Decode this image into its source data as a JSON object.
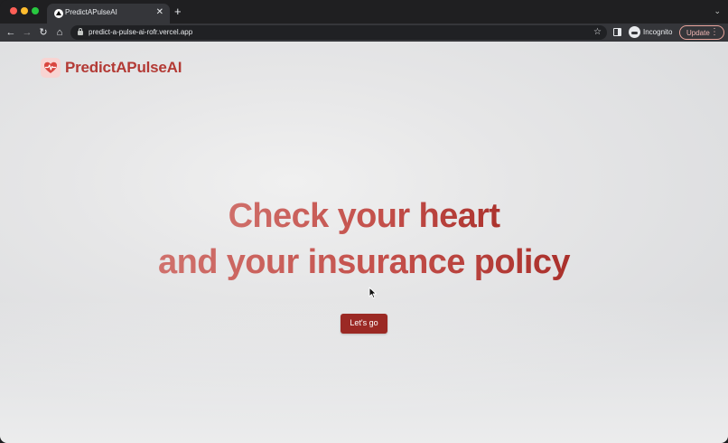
{
  "browser": {
    "tab_title": "PredictAPulseAI",
    "tab_close": "✕",
    "new_tab": "+",
    "tab_menu": "⌄",
    "url": "predict-a-pulse-ai-rofr.vercel.app",
    "incognito_label": "Incognito",
    "update_label": "Update",
    "update_menu": "⋮",
    "nav": {
      "back": "←",
      "forward": "→",
      "reload": "↻",
      "home": "⌂",
      "bookmark": "☆"
    }
  },
  "page": {
    "logo_text": "PredictAPulseAI",
    "hero_line_1": "Check your heart",
    "hero_line_2": "and your insurance policy",
    "cta_label": "Let's go"
  },
  "colors": {
    "brand": "#b33a35",
    "cta_bg": "#9b2924",
    "hero_gradient_start": "#d0726d",
    "hero_gradient_end": "#a92f2a",
    "page_bg": "#e6e6e7"
  },
  "icons": [
    "apple-traffic-lights",
    "vercel-favicon-icon",
    "lock-icon",
    "star-icon",
    "side-panel-icon",
    "incognito-icon",
    "heart-pulse-icon",
    "mouse-cursor-icon"
  ]
}
